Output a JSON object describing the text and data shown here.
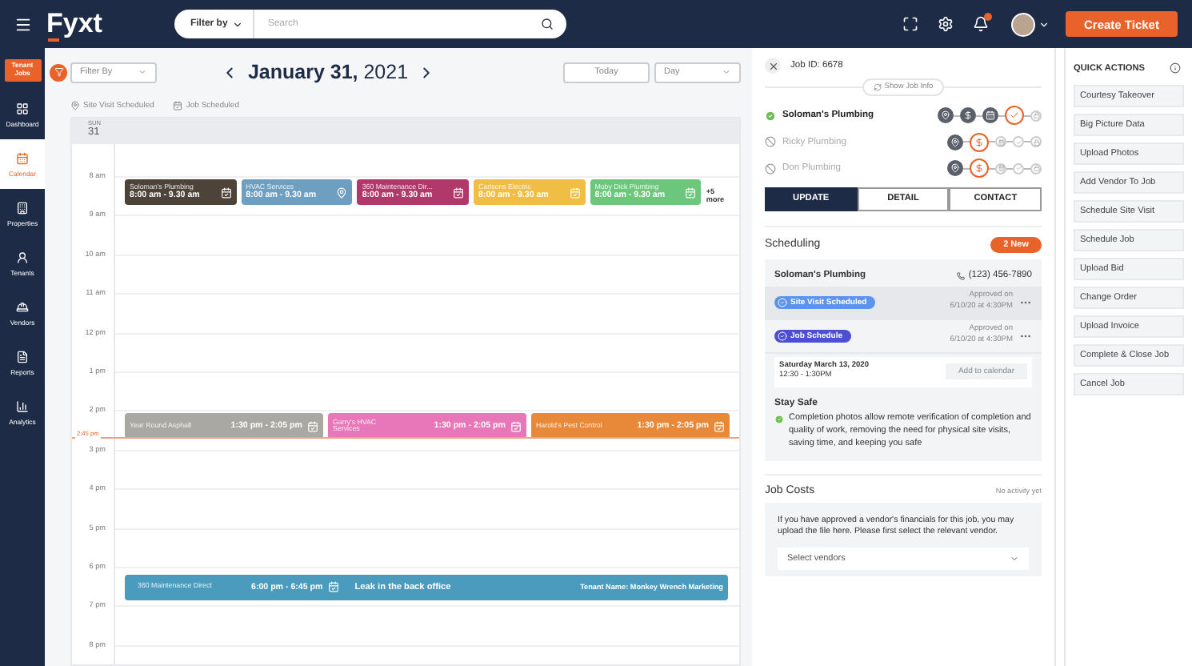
{
  "top_bar": {
    "logo": "Fyxt",
    "search": {
      "filter_label": "Filter by",
      "placeholder": "Search"
    },
    "notification_badge": true,
    "create_button": "Create Ticket"
  },
  "sidebar": {
    "tenant_jobs": "Tenant Jobs",
    "items": [
      {
        "label": "Dashboard",
        "selected": false
      },
      {
        "label": "Calendar",
        "selected": true
      },
      {
        "label": "Properties",
        "selected": false
      },
      {
        "label": "Tenants",
        "selected": false
      },
      {
        "label": "Vendors",
        "selected": false
      },
      {
        "label": "Reports",
        "selected": false
      },
      {
        "label": "Analytics",
        "selected": false
      }
    ]
  },
  "calendar": {
    "filter": {
      "placeholder": "Filter By"
    },
    "month_day": "January 31,",
    "year": "2021",
    "today_button": "Today",
    "view_select": "Day",
    "legend": [
      "Site Visit Scheduled",
      "Job Scheduled"
    ],
    "day_name": "SUN",
    "day_number": "31",
    "hours": [
      {
        "label": "8 am",
        "more": "+5 more",
        "events": [
          {
            "kind": "compact",
            "site_visit": false,
            "title": "Soloman's Plumbing",
            "time": "8:00 am - 9.30 am",
            "color": "#4d4339"
          },
          {
            "kind": "compact",
            "site_visit": true,
            "title": "HVAC Services",
            "time": "8:00 am - 9.30 am",
            "color": "#6f9fc0"
          },
          {
            "kind": "compact",
            "site_visit": false,
            "title": "360 Maintenance Dir...",
            "time": "8:00 am - 9.30 am",
            "color": "#b1386a"
          },
          {
            "kind": "compact",
            "site_visit": false,
            "title": "Carlsons Electric",
            "time": "8:00 am - 9.30 am",
            "color": "#f0be45"
          },
          {
            "kind": "compact",
            "site_visit": false,
            "title": "Moby Dick Plumbing",
            "time": "8:00 am - 9.30 am",
            "color": "#6cc77c"
          }
        ]
      },
      {
        "label": "9 am"
      },
      {
        "label": "10 am"
      },
      {
        "label": "11 am"
      },
      {
        "label": "12 pm"
      },
      {
        "label": "1 pm"
      },
      {
        "label": "2 pm",
        "now_label": "2:45 pm",
        "events": [
          {
            "kind": "wide",
            "site_visit": false,
            "title": "Year Round Asphalt",
            "time": "1:30 pm - 2:05 pm",
            "color": "#a9a8a3"
          },
          {
            "kind": "wide",
            "site_visit": false,
            "title": "Garry's HVAC Services",
            "time": "1:30 pm - 2:05 pm",
            "color": "#e777b9"
          },
          {
            "kind": "wide",
            "site_visit": false,
            "title": "Harold's Pest Control",
            "time": "1:30 pm - 2:05 pm",
            "color": "#e8893a"
          }
        ]
      },
      {
        "label": "3 pm"
      },
      {
        "label": "4 pm"
      },
      {
        "label": "5 pm"
      },
      {
        "label": "6 pm",
        "events": [
          {
            "kind": "banner",
            "site_visit": false,
            "title": "360 Maintenance Direct",
            "time": "6:00 pm - 6:45 pm",
            "description": "Leak in the back office",
            "tenant": "Tenant Name: Monkey Wrench Marketing",
            "color": "#4a9bbd"
          }
        ]
      },
      {
        "label": "7 pm"
      },
      {
        "label": "8 pm"
      }
    ]
  },
  "job": {
    "id_label": "Job ID: 6678",
    "show_info": "Show Job Info",
    "vendors": [
      {
        "name": "Soloman's Plumbing",
        "approved": true,
        "steps": [
          {
            "completed": true,
            "active": false
          },
          {
            "completed": true,
            "active": false
          },
          {
            "completed": true,
            "active": false
          },
          {
            "completed": false,
            "active": true
          },
          {
            "completed": false,
            "active": false
          }
        ]
      },
      {
        "name": "Ricky Plumbing",
        "approved": false,
        "steps": [
          {
            "completed": true,
            "active": false
          },
          {
            "completed": false,
            "active": true
          },
          {
            "completed": false,
            "active": false
          },
          {
            "completed": false,
            "active": false
          },
          {
            "completed": false,
            "active": false
          }
        ]
      },
      {
        "name": "Don Plumbing",
        "approved": false,
        "steps": [
          {
            "completed": true,
            "active": false
          },
          {
            "completed": false,
            "active": true
          },
          {
            "completed": false,
            "active": false
          },
          {
            "completed": false,
            "active": false
          },
          {
            "completed": false,
            "active": false
          }
        ]
      }
    ],
    "tabs": [
      {
        "label": "UPDATE",
        "selected": true
      },
      {
        "label": "DETAIL",
        "selected": false
      },
      {
        "label": "CONTACT",
        "selected": false
      }
    ],
    "scheduling": {
      "title": "Scheduling",
      "badge": "2 New",
      "vendor": "Soloman's Plumbing",
      "phone": "(123) 456-7890",
      "entries": [
        {
          "label": "Site Visit Scheduled",
          "color": "#5b93ee",
          "approved": "Approved on",
          "date": "6/10/20 at 4:30PM",
          "highlighted": true
        },
        {
          "label": "Job Schedule",
          "color": "#4c4fd3",
          "approved": "Approved on",
          "date": "6/10/20 at 4:30PM",
          "highlighted": false
        }
      ],
      "appointment": {
        "date": "Saturday March 13, 2020",
        "time": "12:30 - 1:30PM",
        "button": "Add to calendar"
      },
      "tip": {
        "title": "Stay Safe",
        "text": "Completion photos allow remote verification of completion and quality of work, removing the need for physical site visits, saving time, and keeping you safe"
      }
    },
    "job_costs": {
      "title": "Job Costs",
      "status": "No activity yet",
      "text": "If you have approved a vendor's financials for this job, you may upload the file here. Please first select the relevant vendor.",
      "select": {
        "placeholder": "Select vendors"
      }
    }
  },
  "quick_actions": {
    "title": "QUICK ACTIONS",
    "items": [
      "Courtesy Takeover",
      "Big Picture Data",
      "Upload Photos",
      "Add Vendor To Job",
      "Schedule Site Visit",
      "Schedule Job",
      "Upload Bid",
      "Change Order",
      "Upload Invoice",
      "Complete & Close Job",
      "Cancel Job"
    ]
  }
}
